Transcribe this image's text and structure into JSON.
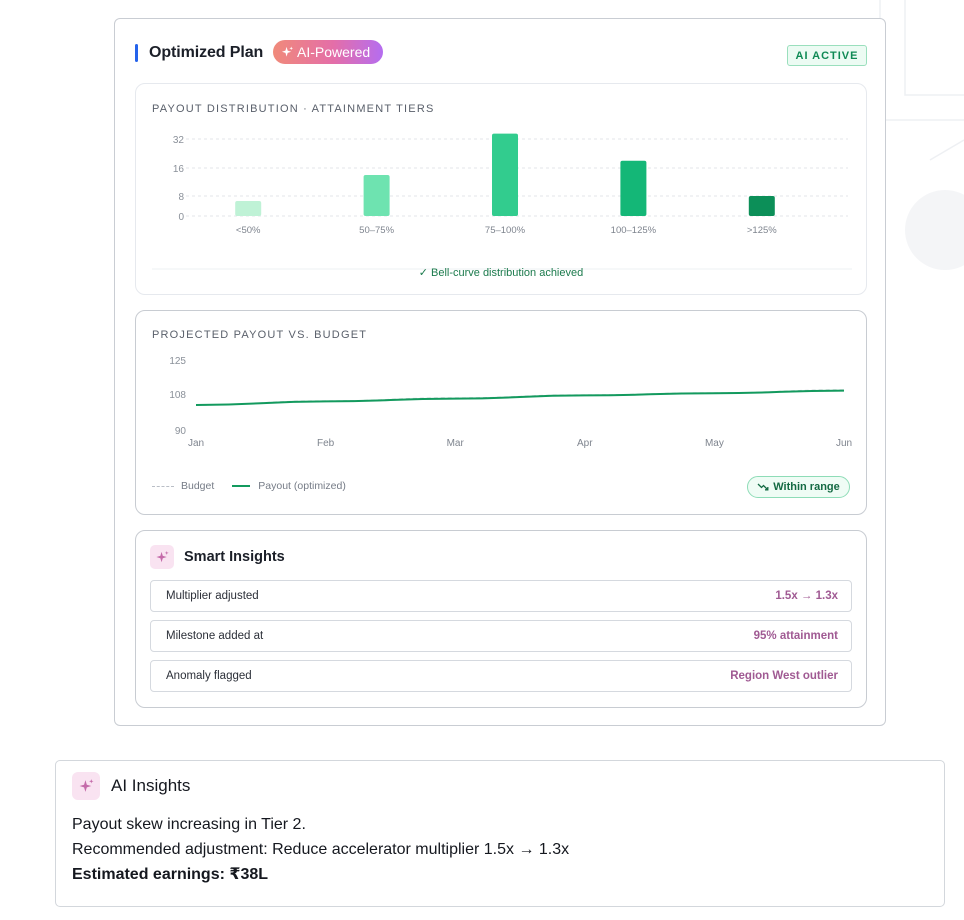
{
  "plan": {
    "title": "Optimized Plan",
    "ai_badge": "AI-Powered",
    "status_badge": "AI ACTIVE"
  },
  "distribution": {
    "label": "PAYOUT DISTRIBUTION · ATTAINMENT TIERS",
    "note": "Bell-curve distribution achieved"
  },
  "projection": {
    "label": "PROJECTED PAYOUT VS. BUDGET",
    "legend_budget": "Budget",
    "legend_payout": "Payout (optimized)",
    "range_badge": "Within range"
  },
  "smart_insights": {
    "title": "Smart Insights",
    "rows": [
      {
        "label": "Multiplier adjusted",
        "value": "1.5x → 1.3x"
      },
      {
        "label": "Milestone added at",
        "value": "95% attainment"
      },
      {
        "label": "Anomaly flagged",
        "value": "Region West outlier"
      }
    ]
  },
  "ai_insights": {
    "title": "AI Insights",
    "line1": "Payout skew increasing in Tier 2.",
    "line2": "Recommended adjustment: Reduce accelerator multiplier 1.5x → 1.3x",
    "line3": "Estimated earnings: ₹38L"
  },
  "colors": {
    "accent": "#2563eb",
    "positive": "#139a5e",
    "insight_value": "#a05a93",
    "bar_tiers": [
      "#bff2d6",
      "#6ee3b0",
      "#32cc8e",
      "#14b777",
      "#0c8f58"
    ]
  },
  "chart_data": [
    {
      "type": "bar",
      "title": "PAYOUT DISTRIBUTION · ATTAINMENT TIERS",
      "categories": [
        "<50%",
        "50–75%",
        "75–100%",
        "100–125%",
        ">125%"
      ],
      "values": [
        6,
        14,
        35,
        20,
        8
      ],
      "yticks": [
        0,
        8,
        16,
        32
      ],
      "grid": true
    },
    {
      "type": "line",
      "title": "PROJECTED PAYOUT VS. BUDGET",
      "categories": [
        "Jan",
        "Feb",
        "Mar",
        "Apr",
        "May",
        "Jun"
      ],
      "ylim": [
        90,
        125
      ],
      "yticks": [
        90,
        108,
        125
      ],
      "series": [
        {
          "name": "Budget",
          "values": [
            102.5,
            104.5,
            106,
            107.5,
            108.5,
            110
          ],
          "style": "dashed"
        },
        {
          "name": "Payout (optimized)",
          "values": [
            102.5,
            104.3,
            105.7,
            107.3,
            108.4,
            109.7
          ],
          "style": "solid"
        }
      ],
      "legend": "bottom-left",
      "grid": false
    }
  ]
}
